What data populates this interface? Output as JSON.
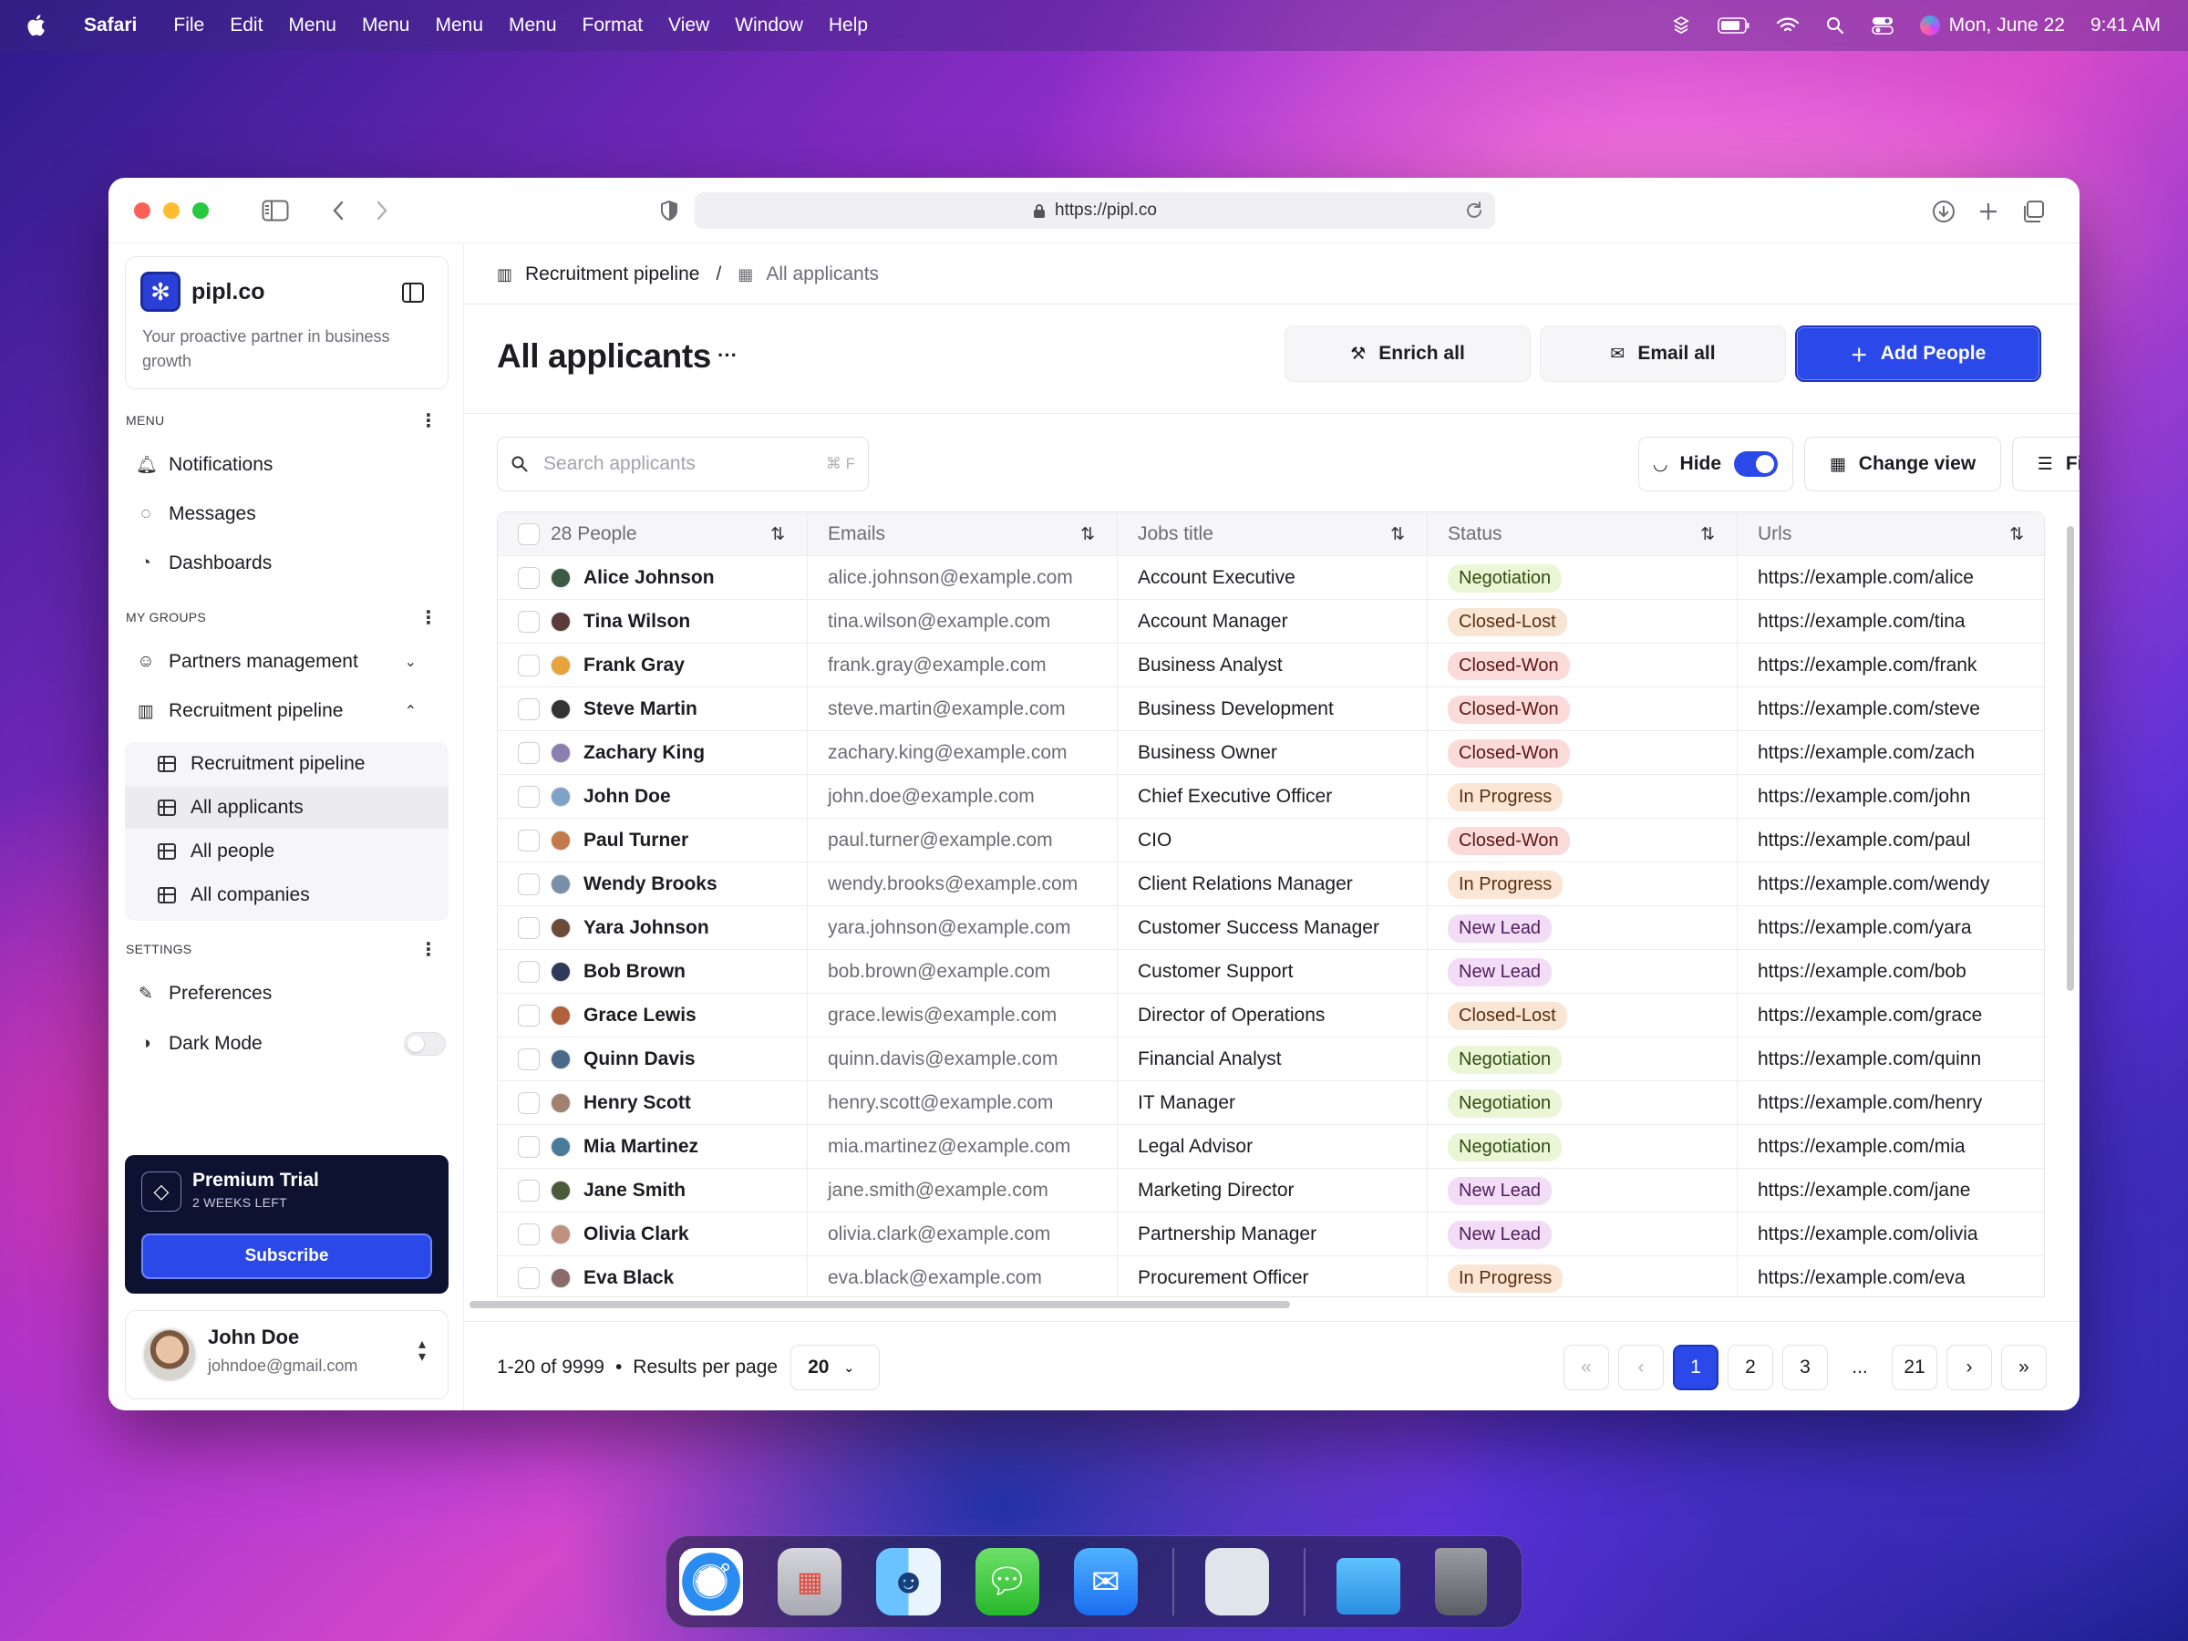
{
  "menubar": {
    "app": "Safari",
    "items": [
      "File",
      "Edit",
      "Menu",
      "Menu",
      "Menu",
      "Menu",
      "Format",
      "View",
      "Window",
      "Help"
    ],
    "date": "Mon, June 22",
    "time": "9:41 AM"
  },
  "browser": {
    "url": "https://pipl.co"
  },
  "sidebar": {
    "brand": {
      "name": "pipl.co",
      "tagline": "Your proactive partner in business growth"
    },
    "menu_title": "MENU",
    "menu": [
      {
        "label": "Notifications",
        "icon": "bell-icon"
      },
      {
        "label": "Messages",
        "icon": "chat-icon"
      },
      {
        "label": "Dashboards",
        "icon": "dashboard-icon"
      }
    ],
    "groups_title": "MY GROUPS",
    "groups": [
      {
        "label": "Partners management",
        "icon": "people-icon",
        "expanded": false
      },
      {
        "label": "Recruitment pipeline",
        "icon": "chart-icon",
        "expanded": true
      }
    ],
    "sub_items": [
      {
        "label": "Recruitment pipeline"
      },
      {
        "label": "All applicants",
        "active": true
      },
      {
        "label": "All people"
      },
      {
        "label": "All companies"
      }
    ],
    "settings_title": "SETTINGS",
    "settings": [
      {
        "label": "Preferences",
        "icon": "brush-icon"
      },
      {
        "label": "Dark Mode",
        "icon": "moon-icon",
        "toggle": false
      }
    ],
    "premium": {
      "title": "Premium Trial",
      "subtitle": "2 WEEKS LEFT",
      "button": "Subscribe"
    },
    "user": {
      "name": "John Doe",
      "email": "johndoe@gmail.com"
    }
  },
  "main": {
    "breadcrumb": [
      "Recruitment pipeline",
      "All applicants"
    ],
    "title": "All applicants",
    "actions": {
      "enrich": "Enrich all",
      "email": "Email all",
      "add": "Add People"
    },
    "search": {
      "placeholder": "Search applicants",
      "shortcut": "⌘ F"
    },
    "tools": {
      "hide": "Hide",
      "hide_on": true,
      "change_view": "Change view",
      "filter": "Filter"
    },
    "columns": [
      "28 People",
      "Emails",
      "Jobs title",
      "Status",
      "Urls"
    ],
    "rows": [
      {
        "name": "Alice Johnson",
        "email": "alice.johnson@example.com",
        "job": "Account Executive",
        "status": "Negotiation",
        "url": "https://example.com/alice"
      },
      {
        "name": "Tina Wilson",
        "email": "tina.wilson@example.com",
        "job": "Account Manager",
        "status": "Closed-Lost",
        "url": "https://example.com/tina"
      },
      {
        "name": "Frank Gray",
        "email": "frank.gray@example.com",
        "job": "Business Analyst",
        "status": "Closed-Won",
        "url": "https://example.com/frank"
      },
      {
        "name": "Steve Martin",
        "email": "steve.martin@example.com",
        "job": "Business Development",
        "status": "Closed-Won",
        "url": "https://example.com/steve"
      },
      {
        "name": "Zachary King",
        "email": "zachary.king@example.com",
        "job": "Business Owner",
        "status": "Closed-Won",
        "url": "https://example.com/zach"
      },
      {
        "name": "John Doe",
        "email": "john.doe@example.com",
        "job": "Chief Executive Officer",
        "status": "In Progress",
        "url": "https://example.com/john"
      },
      {
        "name": "Paul Turner",
        "email": "paul.turner@example.com",
        "job": "CIO",
        "status": "Closed-Won",
        "url": "https://example.com/paul"
      },
      {
        "name": "Wendy Brooks",
        "email": "wendy.brooks@example.com",
        "job": "Client Relations Manager",
        "status": "In Progress",
        "url": "https://example.com/wendy"
      },
      {
        "name": "Yara Johnson",
        "email": "yara.johnson@example.com",
        "job": "Customer Success Manager",
        "status": "New Lead",
        "url": "https://example.com/yara"
      },
      {
        "name": "Bob Brown",
        "email": "bob.brown@example.com",
        "job": "Customer Support",
        "status": "New Lead",
        "url": "https://example.com/bob"
      },
      {
        "name": "Grace Lewis",
        "email": "grace.lewis@example.com",
        "job": "Director of Operations",
        "status": "Closed-Lost",
        "url": "https://example.com/grace"
      },
      {
        "name": "Quinn Davis",
        "email": "quinn.davis@example.com",
        "job": "Financial Analyst",
        "status": "Negotiation",
        "url": "https://example.com/quinn"
      },
      {
        "name": "Henry Scott",
        "email": "henry.scott@example.com",
        "job": "IT Manager",
        "status": "Negotiation",
        "url": "https://example.com/henry"
      },
      {
        "name": "Mia Martinez",
        "email": "mia.martinez@example.com",
        "job": "Legal Advisor",
        "status": "Negotiation",
        "url": "https://example.com/mia"
      },
      {
        "name": "Jane Smith",
        "email": "jane.smith@example.com",
        "job": "Marketing Director",
        "status": "New Lead",
        "url": "https://example.com/jane"
      },
      {
        "name": "Olivia Clark",
        "email": "olivia.clark@example.com",
        "job": "Partnership Manager",
        "status": "New Lead",
        "url": "https://example.com/olivia"
      },
      {
        "name": "Eva Black",
        "email": "eva.black@example.com",
        "job": "Procurement Officer",
        "status": "In Progress",
        "url": "https://example.com/eva"
      }
    ],
    "footer": {
      "range": "1-20 of 9999",
      "rpp_label": "Results per page",
      "rpp_value": "20",
      "pages": [
        "1",
        "2",
        "3",
        "...",
        "21"
      ],
      "current": "1"
    }
  },
  "dock": {
    "apps": [
      "Safari",
      "Launchpad",
      "Finder",
      "Messages",
      "Mail",
      "Preview",
      "Folder",
      "Trash"
    ]
  }
}
